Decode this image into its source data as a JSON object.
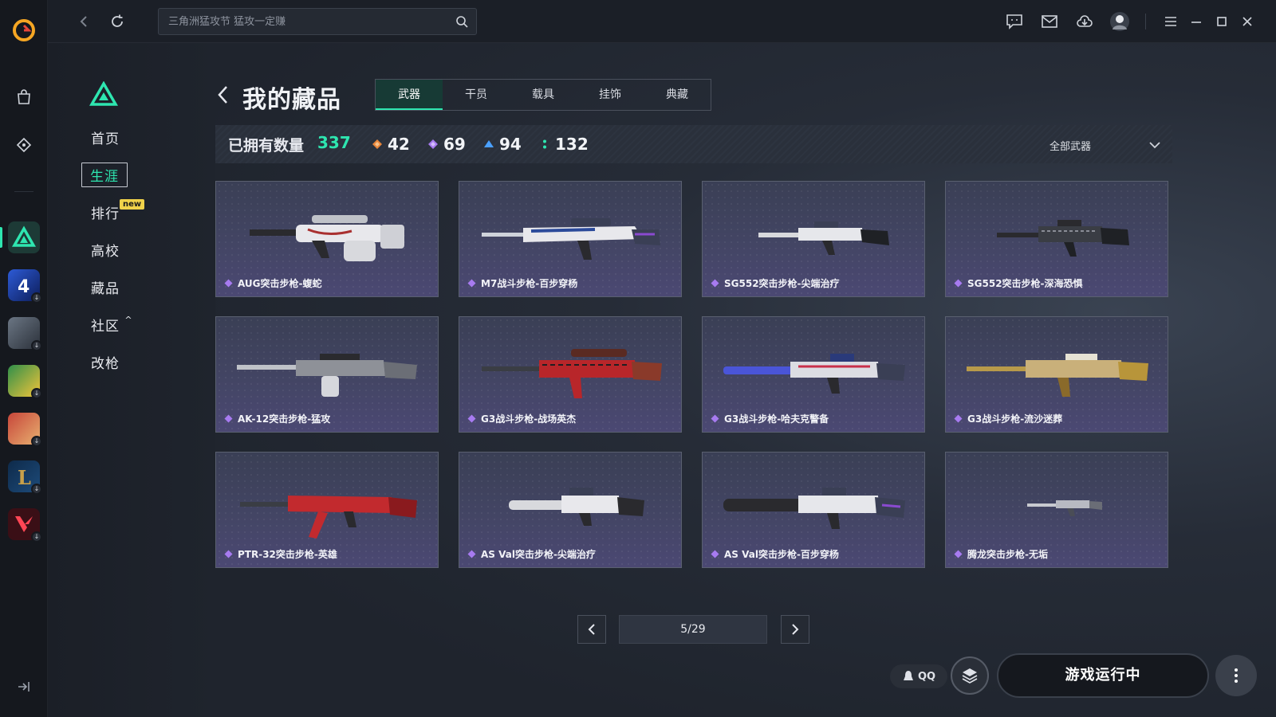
{
  "search": {
    "placeholder": "三角洲猛攻节 猛攻一定赚"
  },
  "subnav": {
    "items": [
      "首页",
      "生涯",
      "排行",
      "高校",
      "藏品",
      "社区",
      "改枪"
    ],
    "active": "生涯",
    "new_badge": "new",
    "community_caret": "^"
  },
  "page": {
    "title": "我的藏品",
    "tabs": [
      "武器",
      "干员",
      "载具",
      "挂饰",
      "典藏"
    ],
    "active_tab": "武器"
  },
  "stats": {
    "owned_label": "已拥有数量",
    "owned_total": "337",
    "tiers": [
      {
        "value": "42",
        "color": "#e8853a"
      },
      {
        "value": "69",
        "color": "#a77bf0"
      },
      {
        "value": "94",
        "color": "#4aa0ff"
      },
      {
        "value": "132",
        "color": "#2ee6b0"
      }
    ],
    "filter": "全部武器"
  },
  "items": [
    {
      "name": "AUG突击步枪-蝮蛇"
    },
    {
      "name": "M7战斗步枪-百步穿杨"
    },
    {
      "name": "SG552突击步枪-尖端治疗"
    },
    {
      "name": "SG552突击步枪-深海恐惧"
    },
    {
      "name": "AK-12突击步枪-猛攻"
    },
    {
      "name": "G3战斗步枪-战场英杰"
    },
    {
      "name": "G3战斗步枪-哈夫克警备"
    },
    {
      "name": "G3战斗步枪-流沙迷葬"
    },
    {
      "name": "PTR-32突击步枪-英雄"
    },
    {
      "name": "AS Val突击步枪-尖端治疗"
    },
    {
      "name": "AS Val突击步枪-百步穿杨"
    },
    {
      "name": "腾龙突击步枪-无垢"
    }
  ],
  "pager": {
    "text": "5/29"
  },
  "bottom": {
    "qq": "QQ",
    "launch": "游戏运行中"
  },
  "colors": {
    "accent": "#2ee6b0",
    "rare_gem": "#a77bf0"
  }
}
